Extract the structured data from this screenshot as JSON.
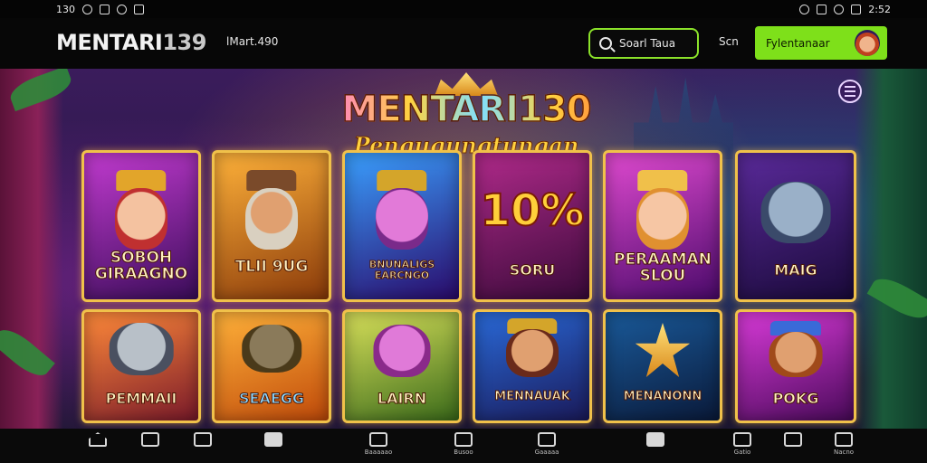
{
  "status_bar": {
    "time_left": "130",
    "time_right": "2:52"
  },
  "header": {
    "brand": "MENTARI",
    "brand_num": "139",
    "subtitle": "lMart.490",
    "search_label": "Soarl Taua",
    "secondary_link": "Scn",
    "cta_label": "Fylentanaar"
  },
  "hero": {
    "title": "MENTARI130",
    "subtitle": "Pengugungtungan"
  },
  "games": [
    {
      "label": "SOBOH\nGIRAAGNO",
      "icon": "queen-icon"
    },
    {
      "label": "TLII 9UG",
      "icon": "old-man-icon"
    },
    {
      "label": "BNUNALIGS\nEARCNGO",
      "icon": "pink-creature-icon"
    },
    {
      "label": "SORU",
      "big": "10%",
      "icon": "percent-icon"
    },
    {
      "label": "PERAAMAN\nSLOU",
      "icon": "princess-icon"
    },
    {
      "label": "MAIG",
      "icon": "wolf-icon"
    },
    {
      "label": "PEMMAII",
      "icon": "anteater-icon"
    },
    {
      "label": "SEAEGG",
      "icon": "stone-mask-icon"
    },
    {
      "label": "LAIRN",
      "icon": "pink-cat-icon"
    },
    {
      "label": "MENNAUAK",
      "icon": "warrior-icon"
    },
    {
      "label": "MENANONN",
      "icon": "star-icon"
    },
    {
      "label": "POKG",
      "icon": "jester-icon"
    }
  ],
  "bottom_nav": [
    {
      "label": "",
      "icon": "home-icon"
    },
    {
      "label": "",
      "icon": "dice-icon"
    },
    {
      "label": "",
      "icon": "gamepad-icon"
    },
    {
      "label": "",
      "icon": "wallet-icon"
    },
    {
      "label": "Baaaaao",
      "icon": "slot-icon"
    },
    {
      "label": "Busoo",
      "icon": "bag-icon"
    },
    {
      "label": "Gaaaaa",
      "icon": "chat-icon"
    },
    {
      "label": "",
      "icon": "cards-icon"
    },
    {
      "label": "Gatio",
      "icon": "heart-icon"
    },
    {
      "label": "",
      "icon": "controller-icon"
    },
    {
      "label": "Nacno",
      "icon": "profile-icon"
    }
  ],
  "colors": {
    "accent_green": "#7ee01a",
    "gold_frame": "#f0c14a"
  }
}
